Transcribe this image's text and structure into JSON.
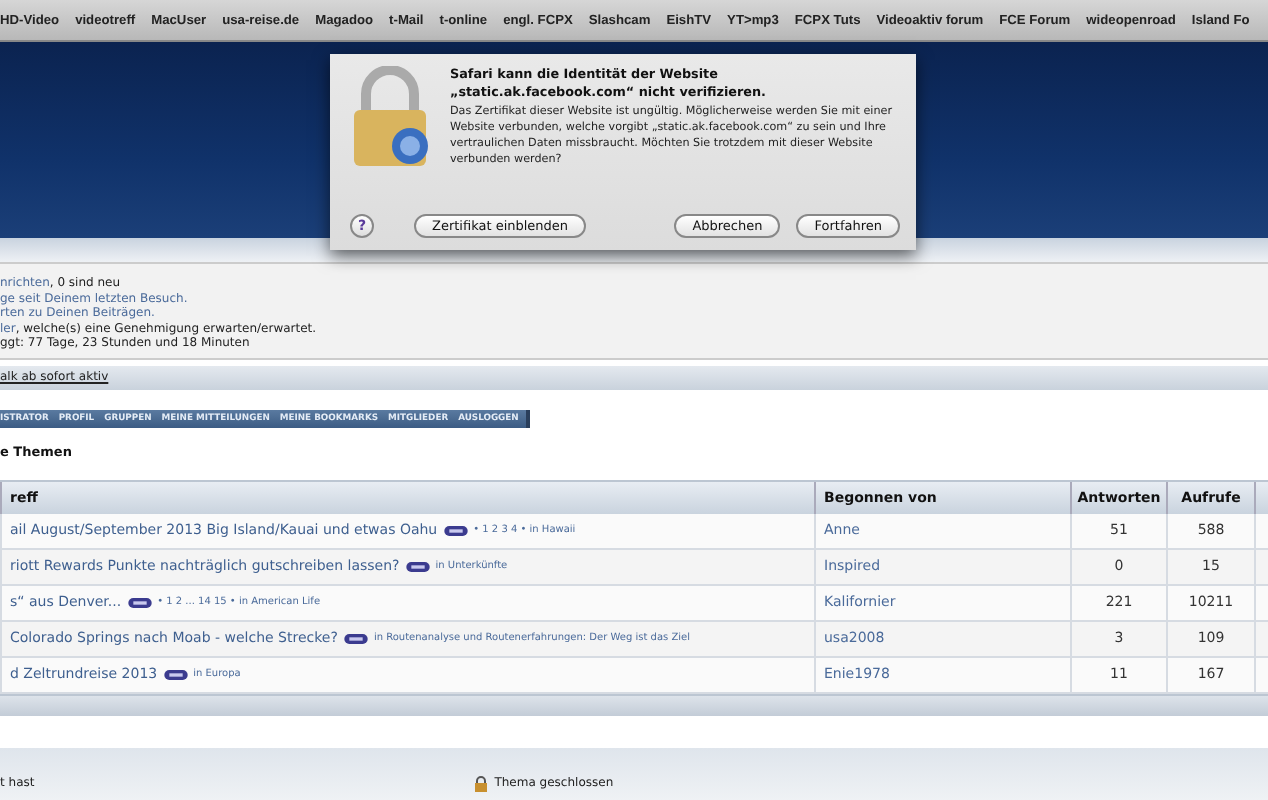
{
  "bookmarks": [
    "HD-Video",
    "videotreff",
    "MacUser",
    "usa-reise.de",
    "Magadoo",
    "t-Mail",
    "t-online",
    "engl. FCPX",
    "Slashcam",
    "EishTV",
    "YT>mp3",
    "FCPX Tuts",
    "Videoaktiv forum",
    "FCE Forum",
    "wideopenroad",
    "Island Fo"
  ],
  "dialog": {
    "title": "Safari kann die Identität der Website „static.ak.facebook.com“ nicht verifizieren.",
    "message": "Das Zertifikat dieser Website ist ungültig. Möglicherweise werden Sie mit einer Website verbunden, welche vorgibt „static.ak.facebook.com“ zu sein und Ihre vertraulichen Daten missbraucht. Möchten Sie trotzdem mit dieser Website verbunden werden?",
    "help": "?",
    "buttons": [
      "Zertifikat einblenden",
      "Abbrechen",
      "Fortfahren"
    ]
  },
  "status_lines": [
    {
      "link": "nrichten",
      "text": ", 0 sind neu"
    },
    {
      "link": "ge seit Deinem letzten Besuch."
    },
    {
      "link": "rten zu Deinen Beiträgen."
    },
    {
      "link": "ler",
      "text": ", welche(s) eine Genehmigung erwarten/erwartet."
    },
    {
      "text": "ggt: 77 Tage, 23 Stunden und 18 Minuten"
    }
  ],
  "notice_link": "alk ab sofort aktiv",
  "nav_items": [
    "ISTRATOR",
    "PROFIL",
    "GRUPPEN",
    "MEINE MITTEILUNGEN",
    "MEINE BOOKMARKS",
    "MITGLIEDER",
    "AUSLOGGEN"
  ],
  "section_title": "e Themen",
  "table": {
    "columns": [
      "reff",
      "Begonnen von",
      "Antworten",
      "Aufrufe"
    ],
    "rows": [
      {
        "title": "ail August/September 2013 Big Island/Kauai und etwas Oahu",
        "meta": "• 1 2 3 4 • in Hawaii",
        "author": "Anne",
        "replies": "51",
        "views": "588"
      },
      {
        "title": "riott Rewards Punkte nachträglich gutschreiben lassen?",
        "meta": "in Unterkünfte",
        "author": "Inspired",
        "replies": "0",
        "views": "15"
      },
      {
        "title": "s“ aus Denver...",
        "meta": "• 1 2 ... 14 15 • in American Life",
        "author": "Kalifornier",
        "replies": "221",
        "views": "10211"
      },
      {
        "title": "Colorado Springs nach Moab - welche Strecke?",
        "meta": "in Routenanalyse und Routenerfahrungen: Der Weg ist das Ziel",
        "author": "usa2008",
        "replies": "3",
        "views": "109"
      },
      {
        "title": "d Zeltrundreise 2013",
        "meta": "in Europa",
        "author": "Enie1978",
        "replies": "11",
        "views": "167"
      }
    ]
  },
  "legend": [
    {
      "locked": false,
      "text": "t hast"
    },
    {
      "locked": true,
      "text": "Thema geschlossen"
    }
  ]
}
